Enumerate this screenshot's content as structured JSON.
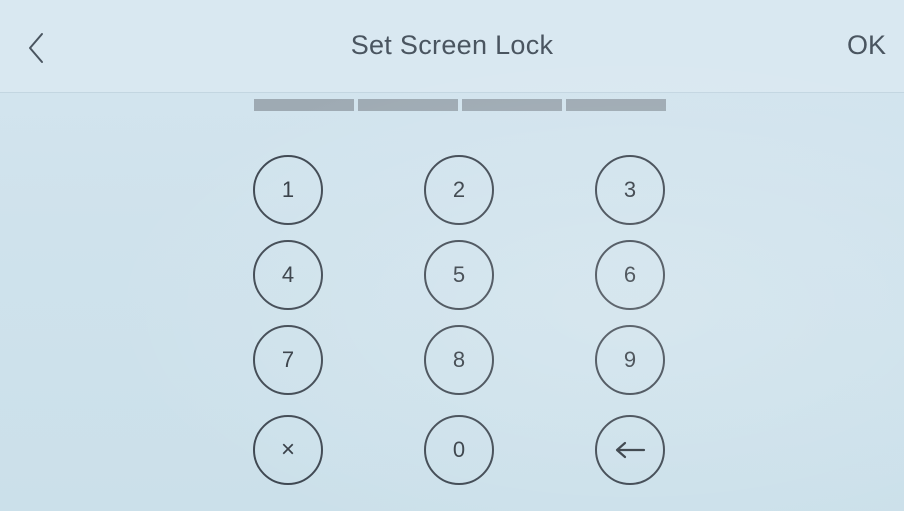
{
  "header": {
    "title": "Set Screen Lock",
    "ok_label": "OK",
    "back_icon": "chevron-left-icon"
  },
  "pin": {
    "slots": 4,
    "entered": 0
  },
  "keypad": {
    "keys": [
      "1",
      "2",
      "3",
      "4",
      "5",
      "6",
      "7",
      "8",
      "9",
      "×",
      "0"
    ],
    "clear_icon": "clear-x-icon",
    "backspace_icon": "backspace-arrow-icon"
  },
  "colors": {
    "background": "#cfe2ec",
    "text": "#4a5560",
    "key_border": "#3d4650",
    "pin_slot": "#9eaab3"
  }
}
